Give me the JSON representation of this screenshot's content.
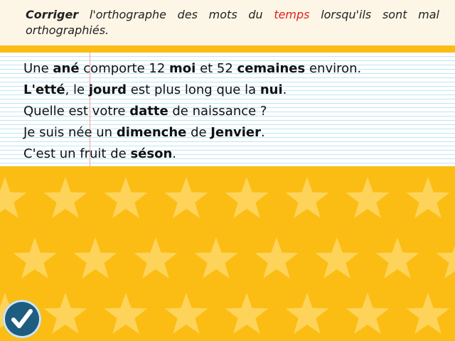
{
  "instruction": {
    "prefix_bold": "Corriger",
    "part1": " l'orthographe des mots du ",
    "highlight": "temps",
    "part2": " lorsqu'ils sont mal orthographiés."
  },
  "sentences": [
    [
      {
        "t": "Une ",
        "b": false
      },
      {
        "t": "ané",
        "b": true
      },
      {
        "t": " comporte 12 ",
        "b": false
      },
      {
        "t": "moi",
        "b": true
      },
      {
        "t": " et 52 ",
        "b": false
      },
      {
        "t": "cemaines",
        "b": true
      },
      {
        "t": " environ.",
        "b": false
      }
    ],
    [
      {
        "t": "L'etté",
        "b": true
      },
      {
        "t": ", le ",
        "b": false
      },
      {
        "t": "jourd",
        "b": true
      },
      {
        "t": " est plus long que la ",
        "b": false
      },
      {
        "t": "nui",
        "b": true
      },
      {
        "t": ".",
        "b": false
      }
    ],
    [
      {
        "t": "Quelle est votre ",
        "b": false
      },
      {
        "t": "datte",
        "b": true
      },
      {
        "t": " de naissance ?",
        "b": false
      }
    ],
    [
      {
        "t": "Je suis née un ",
        "b": false
      },
      {
        "t": "dimenche",
        "b": true
      },
      {
        "t": " de ",
        "b": false
      },
      {
        "t": "Jenvier",
        "b": true
      },
      {
        "t": ".",
        "b": false
      }
    ],
    [
      {
        "t": "C'est un fruit de ",
        "b": false
      },
      {
        "t": "séson",
        "b": true
      },
      {
        "t": ".",
        "b": false
      }
    ]
  ],
  "colors": {
    "background": "#fbbd14",
    "star": "#fdd35a",
    "highlight": "#e02020",
    "button": "#1e5d80"
  },
  "icons": {
    "validate": "check-icon",
    "decoration": "star-icon"
  }
}
